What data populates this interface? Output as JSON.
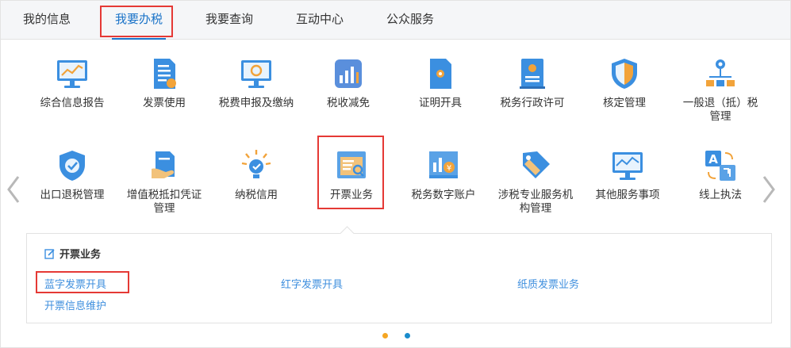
{
  "tabs": [
    {
      "label": "我的信息"
    },
    {
      "label": "我要办税"
    },
    {
      "label": "我要查询"
    },
    {
      "label": "互动中心"
    },
    {
      "label": "公众服务"
    }
  ],
  "row1": [
    {
      "label": "综合信息报告",
      "icon": "monitor-chart-icon"
    },
    {
      "label": "发票使用",
      "icon": "invoice-document-icon"
    },
    {
      "label": "税费申报及缴纳",
      "icon": "monitor-refresh-icon"
    },
    {
      "label": "税收减免",
      "icon": "bar-chart-square-icon"
    },
    {
      "label": "证明开具",
      "icon": "certificate-document-icon"
    },
    {
      "label": "税务行政许可",
      "icon": "license-book-icon"
    },
    {
      "label": "核定管理",
      "icon": "shield-icon"
    },
    {
      "label": "一般退（抵）税管理",
      "icon": "location-network-icon"
    }
  ],
  "row2": [
    {
      "label": "出口退税管理",
      "icon": "shield-check-icon"
    },
    {
      "label": "增值税抵扣凭证管理",
      "icon": "hand-document-icon"
    },
    {
      "label": "纳税信用",
      "icon": "lightbulb-check-icon"
    },
    {
      "label": "开票业务",
      "icon": "invoice-search-icon"
    },
    {
      "label": "税务数字账户",
      "icon": "yuan-chart-board-icon"
    },
    {
      "label": "涉税专业服务机构管理",
      "icon": "tag-icon"
    },
    {
      "label": "其他服务事项",
      "icon": "monitor-line-icon"
    },
    {
      "label": "线上执法",
      "icon": "translate-icon"
    }
  ],
  "panel": {
    "title": "开票业务",
    "links": [
      "蓝字发票开具",
      "红字发票开具",
      "纸质发票业务",
      "开票信息维护"
    ]
  },
  "colors": {
    "accent": "#1a73c8",
    "link": "#3f8fde",
    "highlight": "#e53935",
    "dot_active": "#f5a623",
    "dot_inactive": "#1a8ccc"
  }
}
